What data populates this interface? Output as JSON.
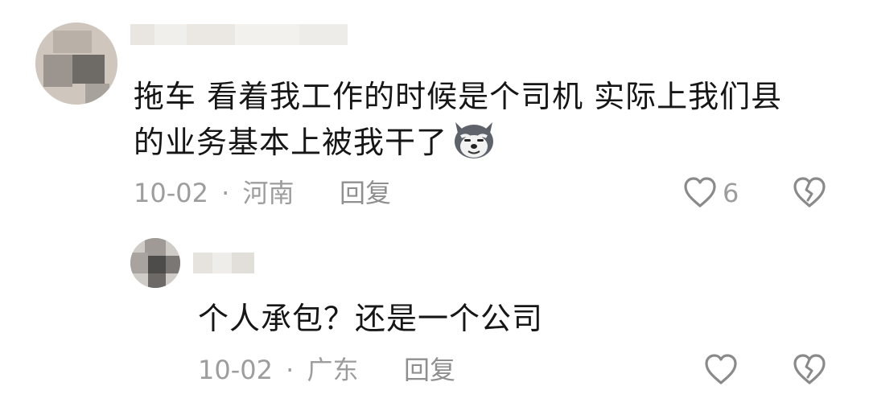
{
  "comments": [
    {
      "text_line1": "拖车 看着我工作的时候是个司机 实际上我们县",
      "text_line2": "的业务基本上被我干了",
      "emoji": "husky-dog-emoji",
      "date": "10-02",
      "separator": "·",
      "location": "河南",
      "reply_label": "回复",
      "like_count": "6"
    },
    {
      "text_line1": "个人承包？还是一个公司",
      "date": "10-02",
      "separator": "·",
      "location": "广东",
      "reply_label": "回复",
      "like_count": ""
    }
  ],
  "icons": {
    "like": "heart-outline-icon",
    "dislike": "broken-heart-icon"
  },
  "colors": {
    "text": "#161616",
    "meta": "#9d9d9d",
    "icon": "#8a8a8a"
  }
}
